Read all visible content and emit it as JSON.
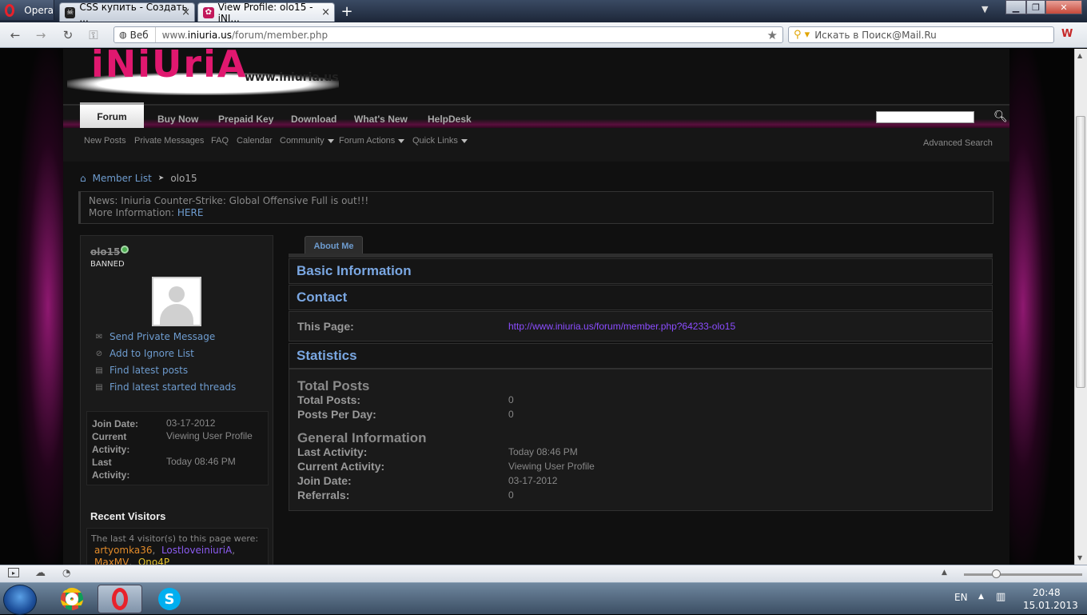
{
  "browser": {
    "menu_label": "Opera",
    "tabs": [
      {
        "label": "CSS купить - Создать ..."
      },
      {
        "label": "View Profile: olo15 - iNI..."
      }
    ],
    "new_tab": "+",
    "address": {
      "mode": "Веб",
      "url_prefix": "www.",
      "url_domain": "iniuria.us",
      "url_path": "/forum/member.php"
    },
    "search_placeholder": "Искать в Поиск@Mail.Ru"
  },
  "site": {
    "logo_text": "iNiUriA",
    "logo_sub": "www.iniuria.us",
    "nav": [
      "Forum",
      "Buy Now",
      "Prepaid Key",
      "Download",
      "What's New",
      "HelpDesk"
    ],
    "subnav": [
      "New Posts",
      "Private Messages",
      "FAQ",
      "Calendar",
      "Community",
      "Forum Actions",
      "Quick Links"
    ],
    "advanced_search": "Advanced Search",
    "breadcrumb": {
      "link": "Member List",
      "current": "olo15"
    },
    "news": {
      "line1": "News: Iniuria Counter-Strike: Global Offensive Full is out!!!",
      "line2_prefix": "More Information: ",
      "line2_link": "HERE"
    }
  },
  "profile": {
    "username": "olo15",
    "status": "BANNED",
    "actions": [
      "Send Private Message",
      "Add to Ignore List",
      "Find latest posts",
      "Find latest started threads"
    ],
    "mini_stats": [
      {
        "label": "Join Date:",
        "value": "03-17-2012"
      },
      {
        "label": "Current Activity:",
        "value": "Viewing User Profile"
      },
      {
        "label": "Last Activity:",
        "value": "Today 08:46 PM"
      }
    ],
    "recent_visitors_title": "Recent Visitors",
    "recent_visitors_text": "The last 4 visitor(s) to this page were:",
    "visitors": [
      {
        "name": "artyomka36",
        "color": "#e38b2a"
      },
      {
        "name": "LostloveiniuriA",
        "color": "#8b5cf0"
      },
      {
        "name": "MaxMV",
        "color": "#e38b2a"
      },
      {
        "name": "Ono4P",
        "color": "#e3c02a"
      }
    ]
  },
  "main": {
    "tab_label": "About Me",
    "sections": {
      "basic": "Basic Information",
      "contact": "Contact",
      "statistics": "Statistics"
    },
    "this_page_label": "This Page:",
    "this_page_url": "http://www.iniuria.us/forum/member.php?64233-olo15",
    "total_posts_group": "Total Posts",
    "total_posts_rows": [
      {
        "label": "Total Posts:",
        "value": "0"
      },
      {
        "label": "Posts Per Day:",
        "value": "0"
      }
    ],
    "general_group": "General Information",
    "general_rows": [
      {
        "label": "Last Activity:",
        "value": "Today 08:46 PM"
      },
      {
        "label": "Current Activity:",
        "value": "Viewing User Profile"
      },
      {
        "label": "Join Date:",
        "value": "03-17-2012"
      },
      {
        "label": "Referrals:",
        "value": "0"
      }
    ]
  },
  "taskbar": {
    "language": "EN",
    "time": "20:48",
    "date": "15.01.2013"
  },
  "colors": {
    "accent_link": "#6e9ccf",
    "section_heading": "#7aa7e2",
    "url_link": "#8b4dff",
    "glow": "#ff2bc8"
  }
}
